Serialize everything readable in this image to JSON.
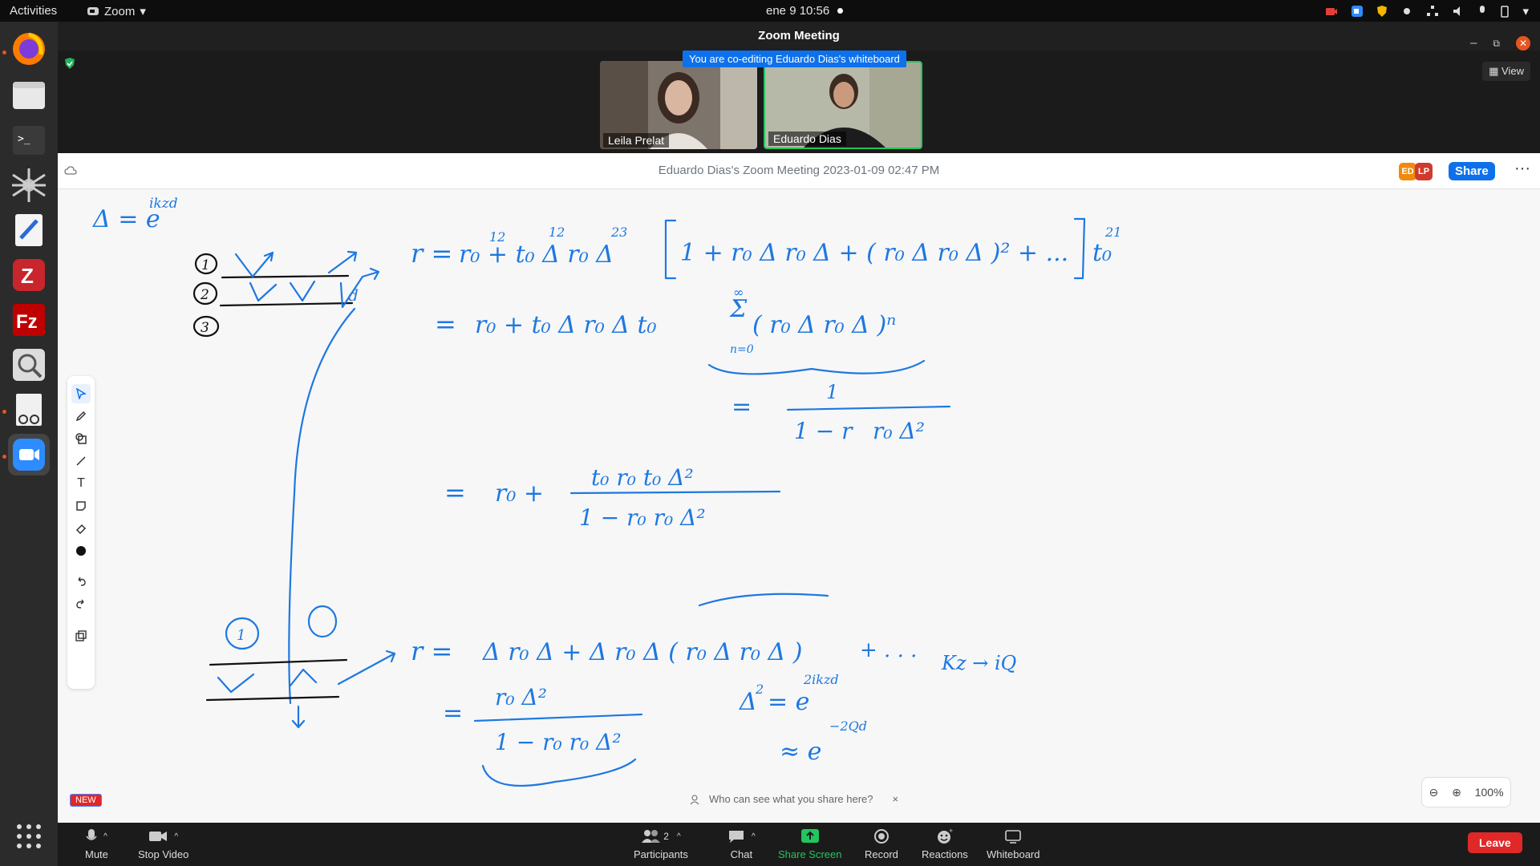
{
  "topbar": {
    "activities": "Activities",
    "app_name": "Zoom",
    "clock": "ene 9  10:56"
  },
  "window": {
    "title": "Zoom Meeting"
  },
  "gallery": {
    "banner": "You are co-editing Eduardo Dias's whiteboard",
    "view_label": "View",
    "participants": [
      {
        "name": "Leila Prelat"
      },
      {
        "name": "Eduardo Dias"
      }
    ]
  },
  "whiteboard": {
    "title": "Eduardo Dias's Zoom Meeting 2023-01-09 02:47 PM",
    "avatars": [
      {
        "initials": "ED",
        "color": "#f08a0c"
      },
      {
        "initials": "LP",
        "color": "#d03a2c"
      }
    ],
    "share_label": "Share",
    "more_label": "···",
    "new_badge": "NEW",
    "hint": "Who can see what you share here?",
    "hint_close": "×",
    "zoom_level": "100%",
    "ink_color": "#1e78e0",
    "math": {
      "delta_def": "Δ = e",
      "delta_exp": "ikzd",
      "layers_top": [
        "1",
        "2",
        "3"
      ],
      "line1_lhs": "r =",
      "line2_eq": "=",
      "sum_top": "∞",
      "sum_bottom": "n=0",
      "geom_num": "1",
      "geom_den": "1 − r",
      "line3_eq": "=",
      "line4_lhs": "r =",
      "delta_sq": "Δ",
      "delta_sq_exp": "2ikzd",
      "approx_exp": "−2Qd",
      "kz_map": "Kz → iQ",
      "dots": "+ . . ."
    }
  },
  "meeting_controls": {
    "mute": "Mute",
    "stop_video": "Stop Video",
    "participants": "Participants",
    "participants_count": "2",
    "chat": "Chat",
    "share_screen": "Share Screen",
    "record": "Record",
    "reactions": "Reactions",
    "whiteboard": "Whiteboard",
    "leave": "Leave"
  }
}
